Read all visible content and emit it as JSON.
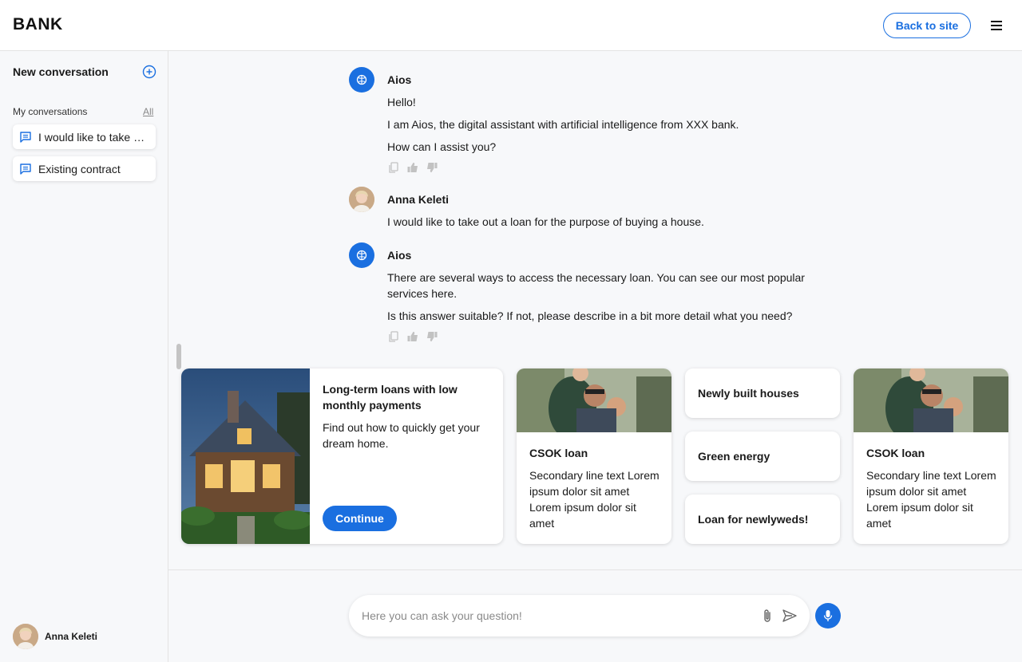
{
  "header": {
    "logo": "BANK",
    "back_label": "Back to site",
    "menu_icon": "hamburger-icon"
  },
  "sidebar": {
    "new_conversation_label": "New conversation",
    "my_conversations_label": "My conversations",
    "all_label": "All",
    "items": [
      {
        "label": "I would like to take out a loan for the purpose of buying a house.",
        "icon": "chat-icon"
      },
      {
        "label": "Existing contract",
        "icon": "chat-icon"
      }
    ],
    "user": {
      "name": "Anna Keleti"
    }
  },
  "chat": {
    "messages": [
      {
        "sender": "Aios",
        "lines": [
          "Hello!",
          "I am Aios, the digital assistant with artificial intelligence from XXX bank.",
          "How can I assist you?"
        ]
      },
      {
        "sender": "Anna Keleti",
        "lines": [
          "I would like to take out a loan for the purpose of buying a house."
        ]
      },
      {
        "sender": "Aios",
        "lines": [
          "There are several ways to access the necessary loan. You can see our most popular services here.",
          "Is this answer suitable? If not, please describe in a bit more detail what you need?"
        ]
      }
    ]
  },
  "cards": {
    "featured": {
      "title": "Long-term loans with low monthly payments",
      "text": "Find out how to quickly get your dream home.",
      "button_label": "Continue"
    },
    "csok_1": {
      "title": "CSOK loan",
      "text": "Secondary line text Lorem ipsum dolor sit amet Lorem ipsum dolor sit amet"
    },
    "topics": [
      {
        "label": "Newly built houses"
      },
      {
        "label": "Green energy"
      },
      {
        "label": "Loan for newlyweds!"
      }
    ],
    "csok_2": {
      "title": "CSOK loan",
      "text": "Secondary line text Lorem ipsum dolor sit amet Lorem ipsum dolor sit amet"
    }
  },
  "composer": {
    "placeholder": "Here you can ask your question!"
  },
  "colors": {
    "accent": "#1a6fe0",
    "background": "#f7f8fa"
  }
}
